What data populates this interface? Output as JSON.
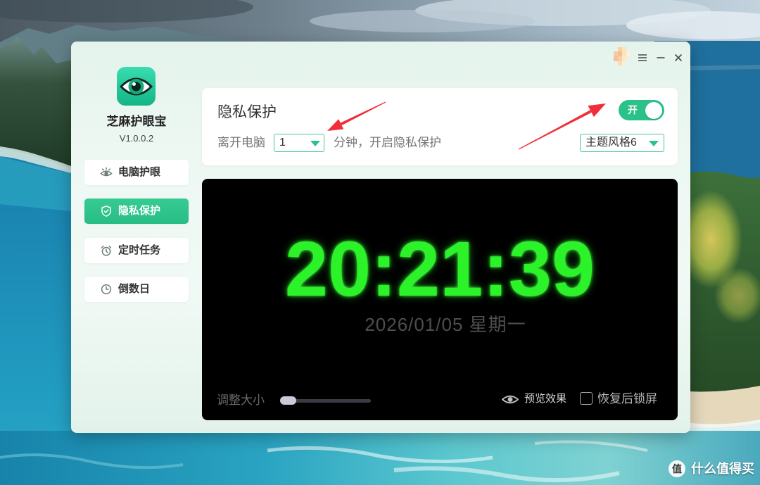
{
  "window": {
    "avatar_icon": "pixelated-avatar-icon",
    "menu_icon": "menu-icon",
    "minimize_icon": "minimize-icon",
    "close_icon": "close-icon"
  },
  "app": {
    "name": "芝麻护眼宝",
    "version": "V1.0.0.2",
    "logo_icon": "eye-logo-icon"
  },
  "sidebar": {
    "items": [
      {
        "label": "电脑护眼",
        "icon": "eye-icon",
        "active": false
      },
      {
        "label": "隐私保护",
        "icon": "shield-icon",
        "active": true
      },
      {
        "label": "定时任务",
        "icon": "alarm-clock-icon",
        "active": false
      },
      {
        "label": "倒数日",
        "icon": "clock-icon",
        "active": false
      }
    ]
  },
  "privacy": {
    "title": "隐私保护",
    "toggle": {
      "label": "开",
      "on": true
    },
    "leave_label": "离开电脑",
    "minutes": {
      "selected": "1"
    },
    "minutes_suffix": "分钟，开启隐私保护",
    "theme": {
      "selected": "主题风格6"
    }
  },
  "preview": {
    "time": "20:21:39",
    "date": "2026/01/05 星期一",
    "size_label": "调整大小",
    "size_value": 0,
    "preview_label": "预览效果",
    "preview_icon": "eye-icon",
    "lock_label": "恢复后锁屏",
    "lock_checked": false
  },
  "watermark": {
    "logo_char": "值",
    "text": "什么值得买"
  },
  "colors": {
    "accent": "#2bc28a",
    "clock": "#2cf22a",
    "date": "#4e4e4e",
    "panel": "#000000",
    "annotation": "#ef3038"
  }
}
